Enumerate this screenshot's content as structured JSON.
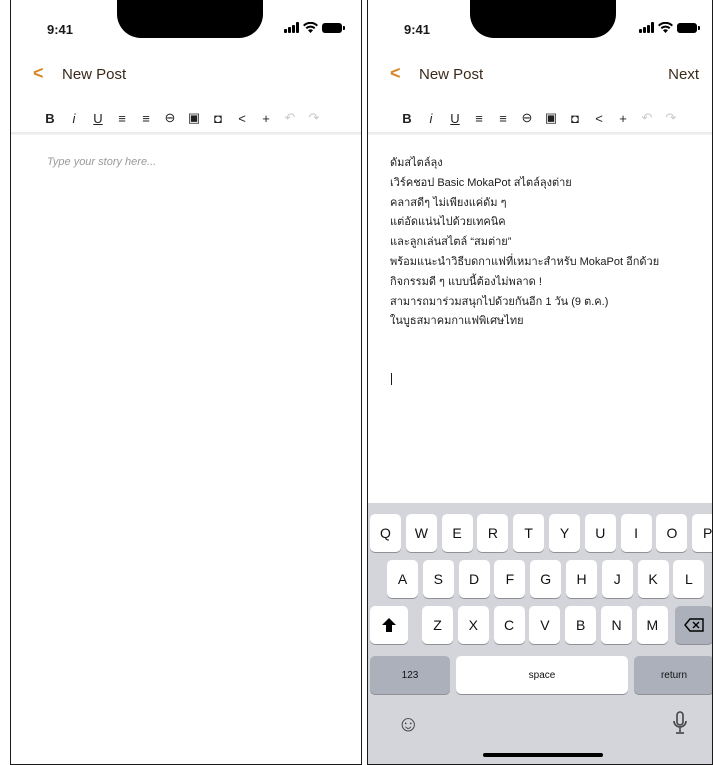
{
  "status": {
    "time": "9:41"
  },
  "left": {
    "nav": {
      "back": "<",
      "title": "New Post"
    },
    "placeholder": "Type your story here..."
  },
  "right": {
    "nav": {
      "back": "<",
      "title": "New Post",
      "next": "Next"
    },
    "story_lines": [
      "ดัมสไตล์ลุง",
      "เวิร์คชอป Basic MokaPot สไตล์ลุงต่าย",
      "คลาสดีๆ ไม่เพียงแค่ดัม ๆ",
      "แต่อัดแน่นไปด้วยเทคนิค",
      "และลูกเล่นสไตล์ “สมต่าย”",
      "พร้อมแนะนำวิธีบดกาแฟที่เหมาะสำหรับ MokaPot อีกด้วย",
      "กิจกรรมดี ๆ แบบนี้ต้องไม่พลาด !",
      "สามารถมาร่วมสนุกไปด้วยกันอีก 1 วัน (9 ต.ค.)",
      "ในบูธสมาคมกาแฟพิเศษไทย"
    ]
  },
  "toolbar": {
    "items": [
      {
        "label": "B",
        "icon": "bold-icon"
      },
      {
        "label": "i",
        "icon": "italic-icon"
      },
      {
        "label": "U",
        "icon": "underline-icon"
      },
      {
        "label": "≡",
        "icon": "align-left-icon"
      },
      {
        "label": "≡",
        "icon": "align-center-icon"
      },
      {
        "label": "⊖",
        "icon": "link-icon"
      },
      {
        "label": "▣",
        "icon": "image-icon"
      },
      {
        "label": "◘",
        "icon": "video-icon"
      },
      {
        "label": "<",
        "icon": "share-icon"
      },
      {
        "label": "+",
        "icon": "insert-icon"
      },
      {
        "label": "↶",
        "icon": "undo-icon"
      },
      {
        "label": "↷",
        "icon": "redo-icon"
      }
    ]
  },
  "keyboard": {
    "row1": [
      "Q",
      "W",
      "E",
      "R",
      "T",
      "Y",
      "U",
      "I",
      "O",
      "P"
    ],
    "row2": [
      "A",
      "S",
      "D",
      "F",
      "G",
      "H",
      "J",
      "K",
      "L"
    ],
    "row3": [
      "Z",
      "X",
      "C",
      "V",
      "B",
      "N",
      "M"
    ],
    "num_label": "123",
    "space_label": "space",
    "return_label": "return",
    "shift_icon": "shift-icon",
    "backspace_icon": "backspace-icon",
    "emoji_icon": "emoji-icon",
    "mic_icon": "microphone-icon"
  },
  "colors": {
    "accent": "#d9862b",
    "keyboard_bg": "#d3d5da"
  }
}
